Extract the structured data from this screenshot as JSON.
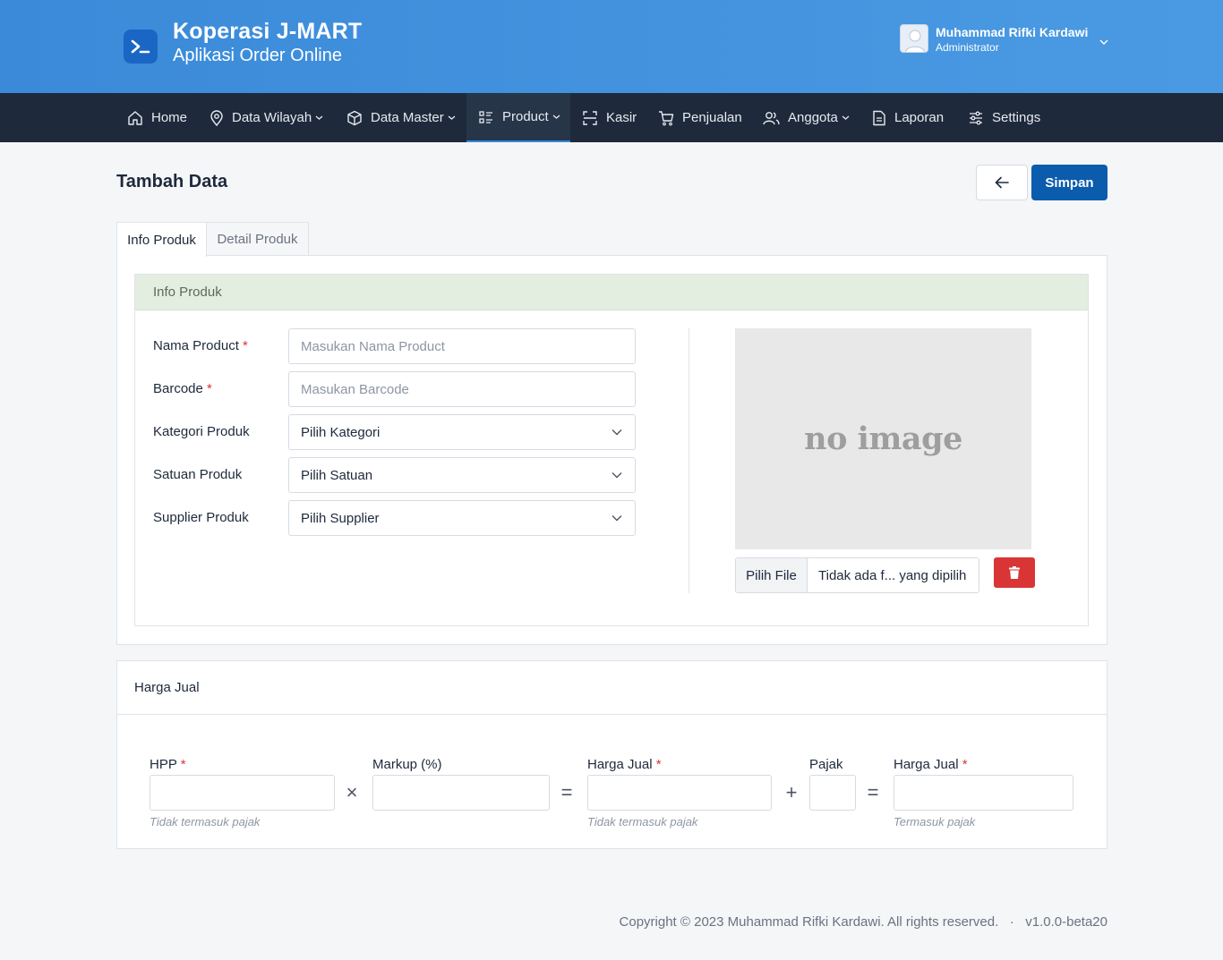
{
  "header": {
    "app_title": "Koperasi J-MART",
    "app_subtitle": "Aplikasi Order Online",
    "user_name": "Muhammad Rifki Kardawi",
    "user_role": "Administrator"
  },
  "nav": {
    "home": "Home",
    "data_wilayah": "Data Wilayah",
    "data_master": "Data Master",
    "product": "Product",
    "kasir": "Kasir",
    "penjualan": "Penjualan",
    "anggota": "Anggota",
    "laporan": "Laporan",
    "settings": "Settings",
    "active": "Product"
  },
  "page": {
    "title": "Tambah Data",
    "save_label": "Simpan"
  },
  "tabs": {
    "info": "Info Produk",
    "detail": "Detail Produk"
  },
  "info_card": {
    "header": "Info Produk",
    "nama_label": "Nama Product",
    "nama_placeholder": "Masukan Nama Product",
    "barcode_label": "Barcode",
    "barcode_placeholder": "Masukan Barcode",
    "kategori_label": "Kategori Produk",
    "kategori_value": "Pilih Kategori",
    "satuan_label": "Satuan Produk",
    "satuan_value": "Pilih Satuan",
    "supplier_label": "Supplier Produk",
    "supplier_value": "Pilih Supplier",
    "required_mark": "*",
    "no_image": "no image",
    "file_button": "Pilih File",
    "file_name": "Tidak ada f... yang dipilih"
  },
  "price": {
    "header": "Harga Jual",
    "hpp_label": "HPP",
    "markup_label": "Markup (%)",
    "harga_jual_label": "Harga Jual",
    "pajak_label": "Pajak",
    "harga_jual_tax_label": "Harga Jual",
    "help_excl": "Tidak termasuk pajak",
    "help_excl_2": "Tidak termasuk pajak",
    "help_incl": "Termasuk pajak",
    "op_times": "×",
    "op_equals": "=",
    "op_plus": "+",
    "op_equals_2": "="
  },
  "footer": {
    "copyright": "Copyright © 2023 Muhammad Rifki Kardawi. All rights reserved.   ·   v1.0.0-beta20"
  },
  "colors": {
    "header_blue": "#3a8ad9",
    "nav_dark": "#1e293b",
    "primary": "#0b5cad",
    "danger": "#d93535",
    "card_header_green": "#e3eee0"
  }
}
